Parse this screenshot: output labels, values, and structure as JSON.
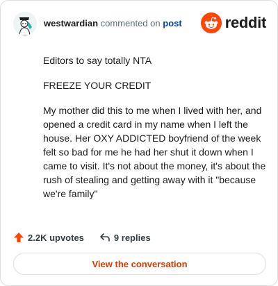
{
  "header": {
    "username": "westwardian",
    "action_text": " commented on ",
    "target_link": "post",
    "brand_name": "reddit",
    "brand_color": "#ff4500"
  },
  "comment": {
    "paragraphs": [
      "Editors to say totally NTA",
      "FREEZE YOUR CREDIT",
      "My mother did this to me when I lived with her, and opened a credit card in my name when I left the house. Her OXY ADDICTED boyfriend of the week felt so bad for me he had her shut it down when I came to visit. It's not about the money, it's about the rush of stealing and getting away with it \"because we're family\""
    ]
  },
  "footer": {
    "upvotes": "2.2K upvotes",
    "replies": "9 replies",
    "upvote_icon": "upvote-arrow-icon",
    "reply_icon": "reply-arrow-icon"
  },
  "cta": {
    "label": "View the conversation",
    "color": "#d93a00"
  }
}
